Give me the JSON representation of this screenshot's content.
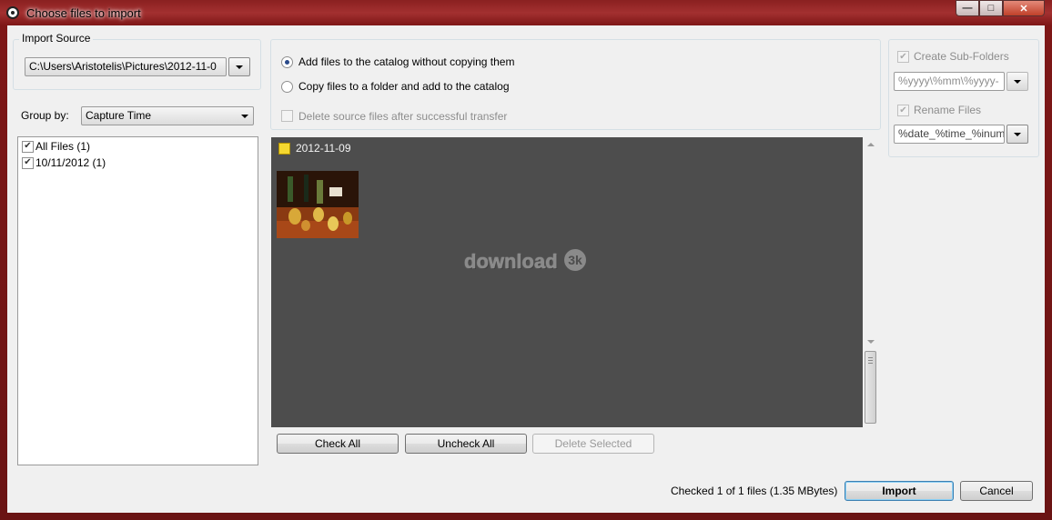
{
  "window": {
    "title": "Choose files to import",
    "accent": "#8a2020"
  },
  "import_source": {
    "group_label": "Import Source",
    "path": "C:\\Users\\Aristotelis\\Pictures\\2012-11-0"
  },
  "group_by": {
    "label": "Group by:",
    "selected": "Capture Time"
  },
  "file_tree": {
    "items": [
      {
        "label": "All Files (1)",
        "checked": true
      },
      {
        "label": "10/11/2012 (1)",
        "checked": true
      }
    ]
  },
  "import_mode": {
    "options": [
      {
        "label": "Add files to the catalog without copying them",
        "selected": true
      },
      {
        "label": "Copy files to a folder and add to the catalog",
        "selected": false
      }
    ],
    "delete_source_label": "Delete source files after successful transfer"
  },
  "destination": {
    "create_subfolders_label": "Create Sub-Folders",
    "subfolder_pattern": "%yyyy\\%mm\\%yyyy-",
    "rename_files_label": "Rename Files",
    "rename_pattern": "%date_%time_%inum"
  },
  "gallery": {
    "folder_name": "2012-11-09",
    "background": "#4d4d4d",
    "watermark": "download",
    "watermark_badge": "3k"
  },
  "gallery_buttons": {
    "check_all": "Check All",
    "uncheck_all": "Uncheck All",
    "delete_selected": "Delete Selected"
  },
  "status": {
    "text": "Checked 1 of 1 files (1.35 MBytes)"
  },
  "dialog_buttons": {
    "import": "Import",
    "cancel": "Cancel"
  }
}
